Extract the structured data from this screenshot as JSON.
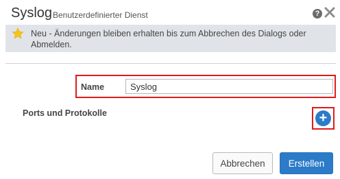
{
  "dialog": {
    "title": "Syslog",
    "subtitle": "Benutzerdefinierter Dienst",
    "help_icon": "question-circle-icon",
    "help_glyph": "?",
    "close_icon": "close-x-icon"
  },
  "notice": {
    "icon": "star-icon",
    "text": "Neu - Änderungen bleiben erhalten bis zum Abbrechen des Dialogs oder Abmelden."
  },
  "form": {
    "name_label": "Name",
    "name_value": "Syslog",
    "ports_label": "Ports und Protokolle",
    "add_icon": "plus-icon",
    "add_glyph": "+"
  },
  "buttons": {
    "cancel_label": "Abbrechen",
    "create_label": "Erstellen"
  },
  "colors": {
    "accent": "#2b7bc9",
    "highlight": "#e01a1a",
    "notice_bg": "#e0e4e8",
    "star": "#f5c518"
  }
}
